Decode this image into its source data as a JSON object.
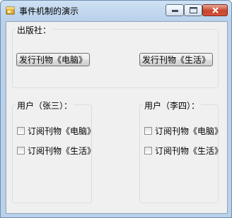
{
  "window": {
    "title": "事件机制的演示",
    "icon": "form-icon",
    "controls": {
      "minimize": "minimize-icon",
      "maximize": "maximize-icon",
      "close": "close-icon"
    }
  },
  "publisher": {
    "label": "出版社：",
    "buttons": [
      {
        "label": "发行刊物《电脑》"
      },
      {
        "label": "发行刊物《生活》"
      }
    ]
  },
  "users": [
    {
      "label": "用户（张三）：",
      "options": [
        {
          "label": "订阅刊物《电脑》",
          "checked": false
        },
        {
          "label": "订阅刊物《生活》",
          "checked": false
        }
      ]
    },
    {
      "label": "用户（李四）：",
      "options": [
        {
          "label": "订阅刊物《电脑》",
          "checked": false
        },
        {
          "label": "订阅刊物《生活》",
          "checked": false
        }
      ]
    }
  ]
}
